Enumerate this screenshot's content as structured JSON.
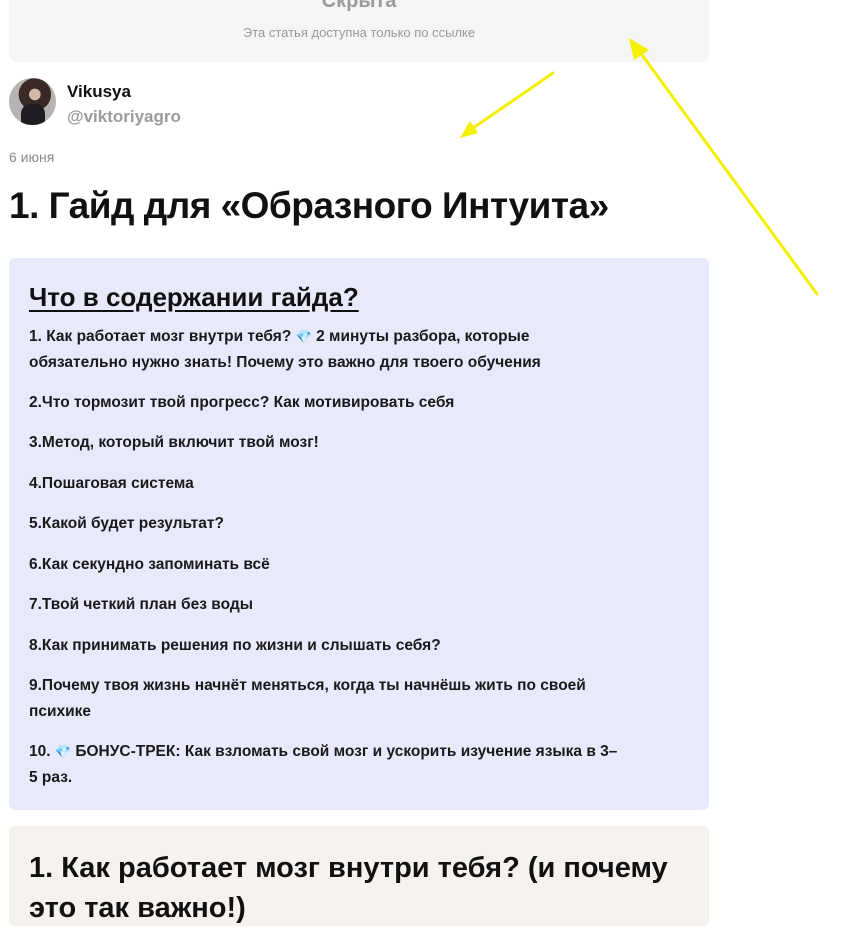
{
  "hidden_notice": {
    "title": "Скрыта",
    "subtitle": "Эта статья доступна только по ссылке"
  },
  "author": {
    "name": "Vikusya",
    "handle": "@viktoriyagro"
  },
  "date": "6 июня",
  "title": "1. Гайд для «Образного Интуита»",
  "toc": {
    "heading": "Что в содержании гайда?",
    "gem_icon": "gem-icon",
    "gem_color": "#2a8fd8",
    "items": [
      {
        "line1_pre": "1. Как работает мозг внутри тебя? ",
        "line1_post": " 2 минуты разбора, которые",
        "line2": "обязательно нужно знать! Почему это важно для твоего обучения"
      },
      {
        "text": "2.Что тормозит твой прогресс? Как мотивировать себя"
      },
      {
        "text": "3.Метод, который включит твой мозг!"
      },
      {
        "text": "4.Пошаговая система"
      },
      {
        "text": "5.Какой будет результат?"
      },
      {
        "text": "6.Как секундно запоминать всё"
      },
      {
        "text": "7.Твой четкий план без воды"
      },
      {
        "text": "8.Как принимать решения по жизни и слышать себя?"
      },
      {
        "line1": "9.Почему твоя жизнь начнёт меняться, когда ты начнёшь жить по своей",
        "line2": "психике"
      },
      {
        "line1_pre": "10. ",
        "line1_post": " БОНУС-ТРЕК: Как взломать свой мозг и ускорить изучение языка в 3–",
        "line2": "5 раз."
      }
    ]
  },
  "section2": {
    "title_line1": "1. Как работает мозг внутри тебя? (и почему",
    "title_line2": "это так важно!)"
  },
  "annotation_color": "#f5f000"
}
